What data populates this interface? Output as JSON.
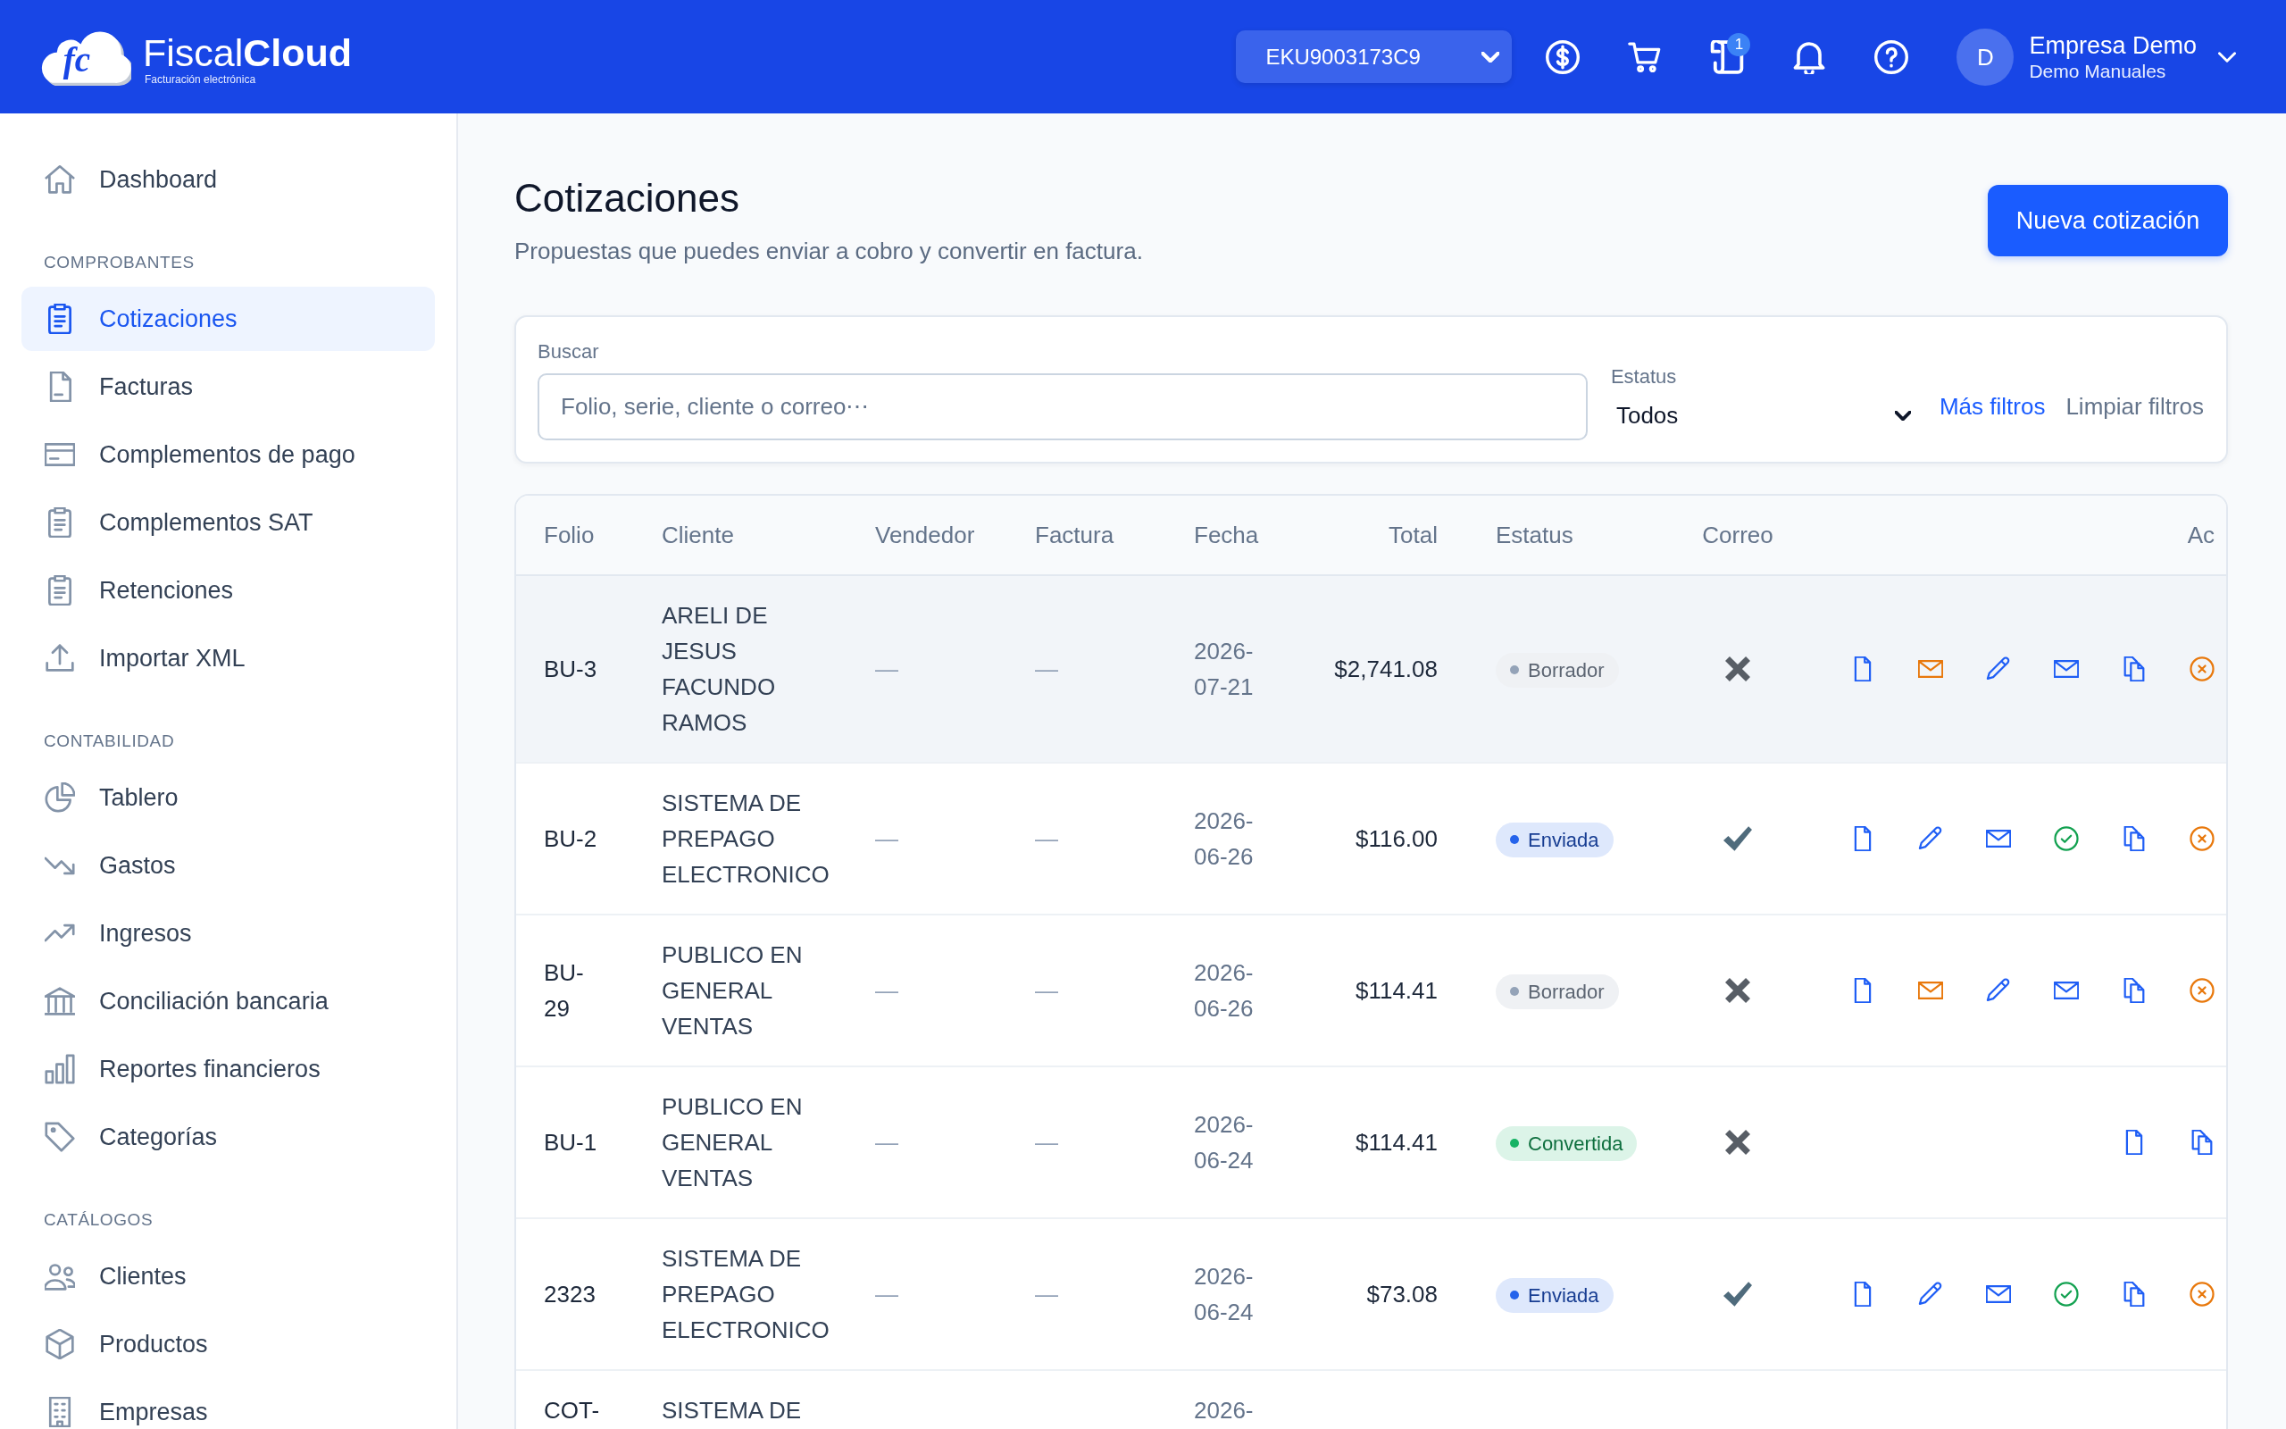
{
  "header": {
    "logo": {
      "mark": "fc",
      "brand": "Fiscal**Cloud**",
      "tagline": "Facturación electrónica"
    },
    "company_select": {
      "value": "EKU9003173C9"
    },
    "notification_count": "1",
    "user": {
      "initial": "D",
      "name": "Empresa Demo",
      "subtitle": "Demo Manuales"
    }
  },
  "sidebar": {
    "sections": [
      {
        "items": [
          {
            "label": "Dashboard",
            "selected": false
          }
        ]
      },
      {
        "title": "COMPROBANTES",
        "items": [
          {
            "label": "Cotizaciones",
            "selected": true
          },
          {
            "label": "Facturas",
            "selected": false
          },
          {
            "label": "Complementos de pago",
            "selected": false
          },
          {
            "label": "Complementos SAT",
            "selected": false
          },
          {
            "label": "Retenciones",
            "selected": false
          },
          {
            "label": "Importar XML",
            "selected": false
          }
        ]
      },
      {
        "title": "CONTABILIDAD",
        "items": [
          {
            "label": "Tablero",
            "selected": false
          },
          {
            "label": "Gastos",
            "selected": false
          },
          {
            "label": "Ingresos",
            "selected": false
          },
          {
            "label": "Conciliación bancaria",
            "selected": false
          },
          {
            "label": "Reportes financieros",
            "selected": false
          },
          {
            "label": "Categorías",
            "selected": false
          }
        ]
      },
      {
        "title": "CATÁLOGOS",
        "items": [
          {
            "label": "Clientes",
            "selected": false
          },
          {
            "label": "Productos",
            "selected": false
          },
          {
            "label": "Empresas",
            "selected": false
          }
        ]
      }
    ]
  },
  "page": {
    "title": "Cotizaciones",
    "subtitle": "Propuestas que puedes enviar a cobro y convertir en factura.",
    "new_button": "Nueva cotización"
  },
  "filters": {
    "search": {
      "label": "Buscar",
      "placeholder": "Folio, serie, cliente o correo⋯"
    },
    "status": {
      "label": "Estatus",
      "value": "Todos"
    },
    "more_filters": "Más filtros",
    "clear_filters": "Limpiar filtros"
  },
  "table": {
    "columns": [
      "Folio",
      "Cliente",
      "Vendedor",
      "Factura",
      "Fecha",
      "Total",
      "Estatus",
      "Correo",
      "Ac"
    ],
    "rows": [
      {
        "folio": "BU-3",
        "client": "ARELI DE JESUS FACUNDO RAMOS",
        "seller": "—",
        "invoice": "—",
        "date": "2026-07-21",
        "total": "$2,741.08",
        "status": {
          "label": "Borrador",
          "color": "#94a3b8"
        },
        "email_sent": false,
        "highlighted": true,
        "actions": [
          {
            "kind": "document",
            "color": "#1f5ef5"
          },
          {
            "kind": "mail",
            "color": "#e8780c"
          },
          {
            "kind": "edit",
            "color": "#1f5ef5"
          },
          {
            "kind": "mail",
            "color": "#1f5ef5"
          },
          {
            "kind": "copy",
            "color": "#1f5ef5"
          },
          {
            "kind": "cancel",
            "color": "#e8780c"
          }
        ]
      },
      {
        "folio": "BU-2",
        "client": "SISTEMA DE PREPAGO ELECTRONICO",
        "seller": "—",
        "invoice": "—",
        "date": "2026-06-26",
        "total": "$116.00",
        "status": {
          "label": "Enviada",
          "color": "#2563eb"
        },
        "email_sent": true,
        "highlighted": false,
        "actions": [
          {
            "kind": "document",
            "color": "#1f5ef5"
          },
          {
            "kind": "edit",
            "color": "#1f5ef5"
          },
          {
            "kind": "mail",
            "color": "#1f5ef5"
          },
          {
            "kind": "check",
            "color": "#12a150"
          },
          {
            "kind": "copy",
            "color": "#1f5ef5"
          },
          {
            "kind": "cancel",
            "color": "#e8780c"
          }
        ]
      },
      {
        "folio": "BU-29",
        "client": "PUBLICO EN GENERAL VENTAS",
        "seller": "—",
        "invoice": "—",
        "date": "2026-06-26",
        "total": "$114.41",
        "status": {
          "label": "Borrador",
          "color": "#94a3b8"
        },
        "email_sent": false,
        "highlighted": false,
        "actions": [
          {
            "kind": "document",
            "color": "#1f5ef5"
          },
          {
            "kind": "mail",
            "color": "#e8780c"
          },
          {
            "kind": "edit",
            "color": "#1f5ef5"
          },
          {
            "kind": "mail",
            "color": "#1f5ef5"
          },
          {
            "kind": "copy",
            "color": "#1f5ef5"
          },
          {
            "kind": "cancel",
            "color": "#e8780c"
          }
        ]
      },
      {
        "folio": "BU-1",
        "client": "PUBLICO EN GENERAL VENTAS",
        "seller": "—",
        "invoice": "—",
        "date": "2026-06-24",
        "total": "$114.41",
        "status": {
          "label": "Convertida",
          "color": "#16b364"
        },
        "email_sent": false,
        "highlighted": false,
        "actions": [
          {
            "kind": "document",
            "color": "#1f5ef5"
          },
          {
            "kind": "copy",
            "color": "#1f5ef5"
          }
        ]
      },
      {
        "folio": "2323",
        "client": "SISTEMA DE PREPAGO ELECTRONICO",
        "seller": "—",
        "invoice": "—",
        "date": "2026-06-24",
        "total": "$73.08",
        "status": {
          "label": "Enviada",
          "color": "#2563eb"
        },
        "email_sent": true,
        "highlighted": false,
        "actions": [
          {
            "kind": "document",
            "color": "#1f5ef5"
          },
          {
            "kind": "edit",
            "color": "#1f5ef5"
          },
          {
            "kind": "mail",
            "color": "#1f5ef5"
          },
          {
            "kind": "check",
            "color": "#12a150"
          },
          {
            "kind": "copy",
            "color": "#1f5ef5"
          },
          {
            "kind": "cancel",
            "color": "#e8780c"
          }
        ]
      },
      {
        "folio": "COT-",
        "client": "SISTEMA DE",
        "date": "2026-",
        "highlighted": false
      }
    ]
  }
}
